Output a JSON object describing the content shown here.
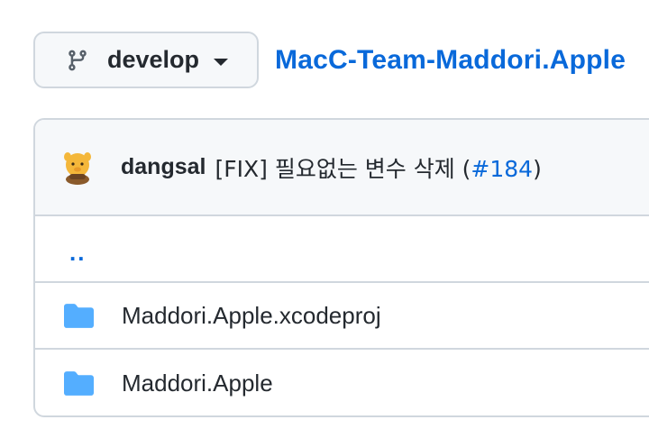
{
  "branch_selector": {
    "label": "develop",
    "icon": "git-branch-icon",
    "dropdown_icon": "triangle-down-icon"
  },
  "repo": {
    "name": "MacC-Team-Maddori.Apple"
  },
  "latest_commit": {
    "author": "dangsal",
    "message_prefix": "[FIX] 필요없는 변수 삭제 (",
    "pr_link": "#184",
    "message_suffix": ")"
  },
  "file_list": {
    "parent_dir": "..",
    "items": [
      {
        "name": "Maddori.Apple.xcodeproj",
        "icon": "folder-icon"
      },
      {
        "name": "Maddori.Apple",
        "icon": "folder-icon"
      }
    ]
  },
  "colors": {
    "link": "#0969da",
    "folder": "#54aeff",
    "border": "#d0d7de",
    "header_bg": "#f6f8fa"
  }
}
